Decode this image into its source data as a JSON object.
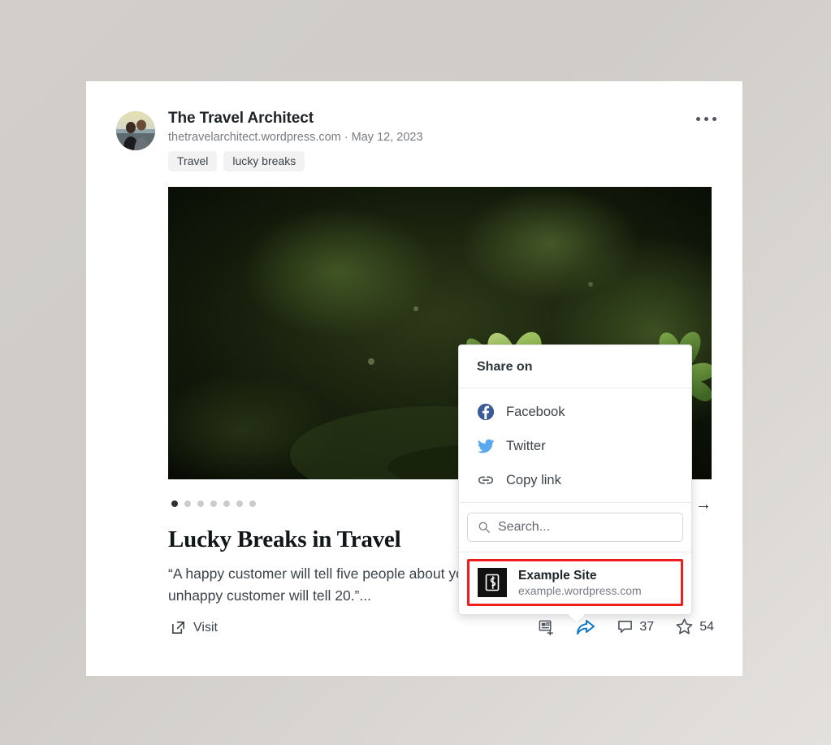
{
  "post": {
    "site_name": "The Travel Architect",
    "site_url": "thetravelarchitect.wordpress.com",
    "separator": "·",
    "date": "May 12, 2023",
    "tags": [
      "Travel",
      "lucky breaks"
    ],
    "title": "Lucky Breaks in Travel",
    "excerpt": "“A happy customer will tell five people about you; an unhappy customer will tell 20.”...",
    "more_menu_label": "More options"
  },
  "carousel": {
    "total_dots": 7,
    "active_index": 0,
    "next_label": "→"
  },
  "actions": {
    "visit_label": "Visit",
    "add_to_list_label": "Add to list",
    "share_label": "Share",
    "comment_count": "37",
    "like_count": "54"
  },
  "share_popover": {
    "header": "Share on",
    "items": [
      {
        "label": "Facebook",
        "icon": "facebook-icon",
        "color": "#3c5a99"
      },
      {
        "label": "Twitter",
        "icon": "twitter-icon",
        "color": "#58a9ef"
      },
      {
        "label": "Copy link",
        "icon": "link-icon",
        "color": "#50575e"
      }
    ],
    "search": {
      "placeholder": "Search...",
      "value": "",
      "icon": "search-icon"
    },
    "sites": [
      {
        "title": "Example Site",
        "url": "example.wordpress.com",
        "highlighted": true
      }
    ]
  },
  "colors": {
    "accent_blue": "#0675c4",
    "highlight_red": "#f01d1d",
    "card_background": "#ffffff",
    "page_background": "#cfccc8"
  }
}
